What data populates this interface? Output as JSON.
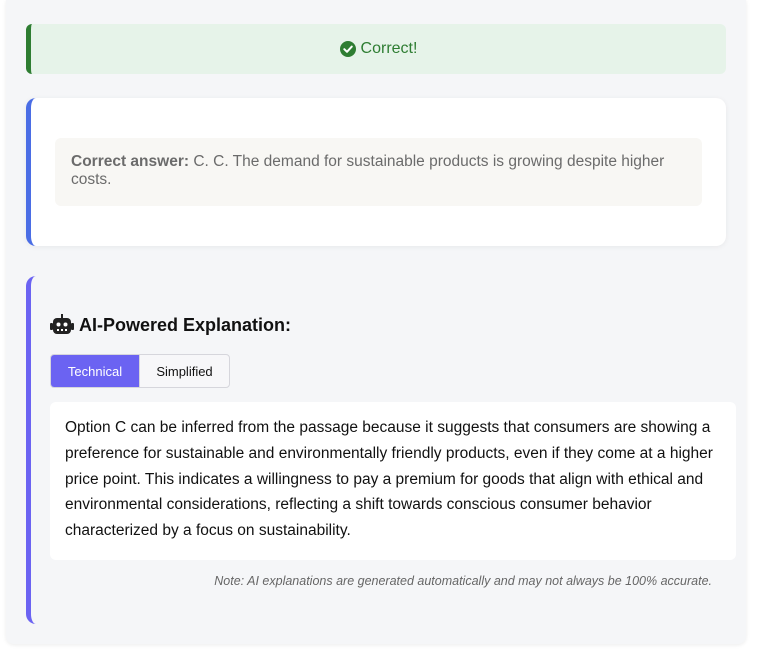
{
  "status": {
    "label": "Correct!",
    "color": "#2e7d32"
  },
  "answer": {
    "prefix": "Correct answer:",
    "text": "C. C. The demand for sustainable products is growing despite higher costs."
  },
  "explanation": {
    "title": "AI-Powered Explanation:",
    "tabs": [
      "Technical",
      "Simplified"
    ],
    "active_tab": "Technical",
    "body": "Option C can be inferred from the passage because it suggests that consumers are showing a preference for sustainable and environmentally friendly products, even if they come at a higher price point. This indicates a willingness to pay a premium for goods that align with ethical and environmental considerations, reflecting a shift towards conscious consumer behavior characterized by a focus on sustainability.",
    "note": "Note: AI explanations are generated automatically and may not always be 100% accurate."
  },
  "icons": {
    "status": "check-circle-icon",
    "explanation": "robot-icon"
  },
  "colors": {
    "success_bg": "#e6f3e9",
    "answer_accent": "#4a6de5",
    "explain_accent": "#6b63f2"
  }
}
